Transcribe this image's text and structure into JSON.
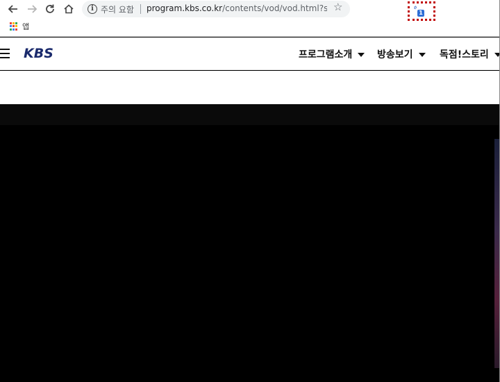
{
  "browser": {
    "security_warning": "주의 요함",
    "url_host": "program.kbs.co.kr",
    "url_path": "/contents/vod/vod.html?sourc...",
    "extension_badge": "1",
    "bookmarks": {
      "apps_label": "앱"
    }
  },
  "site": {
    "logo": "KBS",
    "menu": [
      {
        "label": "프로그램소개"
      },
      {
        "label": "방송보기"
      },
      {
        "label": "독점!스토리"
      }
    ]
  },
  "colors": {
    "logo": "#1a2a6c",
    "extension_highlight": "#c00000",
    "video_bg": "#000000"
  }
}
